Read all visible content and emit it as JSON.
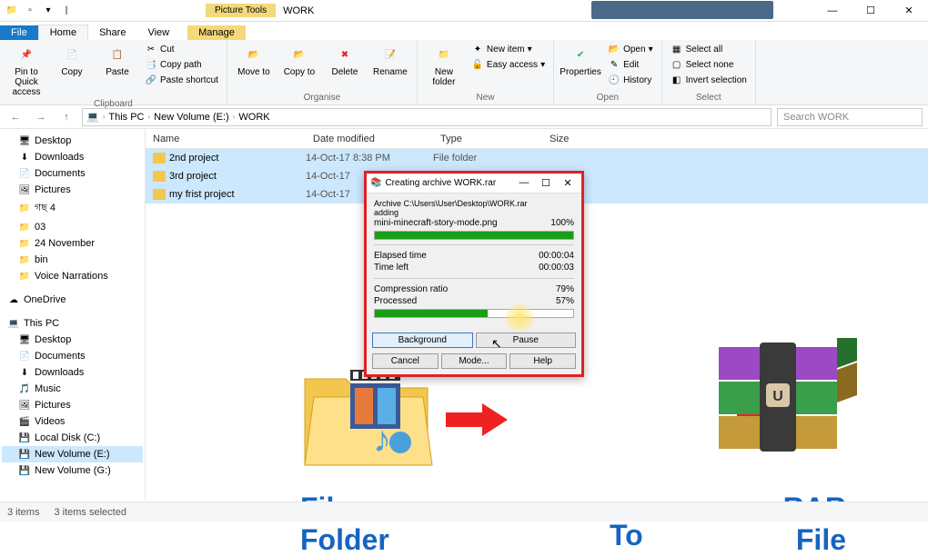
{
  "titlebar": {
    "contextual": "Picture Tools",
    "title": "WORK",
    "min": "—",
    "max": "☐",
    "close": "✕"
  },
  "tabs": {
    "file": "File",
    "home": "Home",
    "share": "Share",
    "view": "View",
    "manage": "Manage"
  },
  "ribbon": {
    "pin": "Pin to Quick access",
    "copy": "Copy",
    "paste": "Paste",
    "cut": "Cut",
    "copypath": "Copy path",
    "pasteshortcut": "Paste shortcut",
    "clipboard": "Clipboard",
    "moveto": "Move to",
    "copyto": "Copy to",
    "delete": "Delete",
    "rename": "Rename",
    "organise": "Organise",
    "newfolder": "New folder",
    "newitem": "New item",
    "easyaccess": "Easy access",
    "new": "New",
    "properties": "Properties",
    "open": "Open",
    "edit": "Edit",
    "history": "History",
    "open_grp": "Open",
    "selectall": "Select all",
    "selectnone": "Select none",
    "invert": "Invert selection",
    "select": "Select"
  },
  "address": {
    "root": "This PC",
    "vol": "New Volume (E:)",
    "folder": "WORK",
    "search_placeholder": "Search WORK"
  },
  "sidebar": {
    "desktop": "Desktop",
    "downloads": "Downloads",
    "documents": "Documents",
    "pictures": "Pictures",
    "item1": "গছ 4",
    "item2": "03",
    "item3": "24 November",
    "item4": "bin",
    "item5": "Voice Narrations",
    "onedrive": "OneDrive",
    "thispc": "This PC",
    "tp_desktop": "Desktop",
    "tp_documents": "Documents",
    "tp_downloads": "Downloads",
    "tp_music": "Music",
    "tp_pictures": "Pictures",
    "tp_videos": "Videos",
    "localc": "Local Disk (C:)",
    "newvole": "New Volume (E:)",
    "newvolg": "New Volume (G:)"
  },
  "columns": {
    "name": "Name",
    "date": "Date modified",
    "type": "Type",
    "size": "Size"
  },
  "files": [
    {
      "name": "2nd project",
      "date": "14-Oct-17 8:38 PM",
      "type": "File folder"
    },
    {
      "name": "3rd project",
      "date": "14-Oct-17",
      "type": ""
    },
    {
      "name": "my frist project",
      "date": "14-Oct-17",
      "type": ""
    }
  ],
  "dialog": {
    "title": "Creating archive WORK.rar",
    "archive_label": "Archive C:\\Users\\User\\Desktop\\WORK.rar",
    "adding": "adding",
    "current_file": "mini-minecraft-story-mode.png",
    "current_pct": "100%",
    "elapsed_label": "Elapsed time",
    "elapsed": "00:00:04",
    "left_label": "Time left",
    "left": "00:00:03",
    "ratio_label": "Compression ratio",
    "ratio": "79%",
    "processed_label": "Processed",
    "processed": "57%",
    "btn_bg": "Background",
    "btn_pause": "Pause",
    "btn_cancel": "Cancel",
    "btn_mode": "Mode...",
    "btn_help": "Help"
  },
  "overlay": {
    "left1": "File or",
    "left2": "Folder",
    "mid": "To",
    "right1": "RAR",
    "right2": "File"
  },
  "status": {
    "items": "3 items",
    "selected": "3 items selected"
  }
}
